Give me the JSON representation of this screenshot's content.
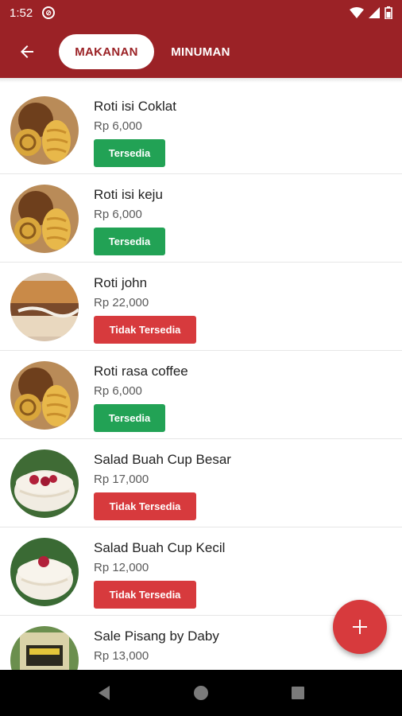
{
  "status_bar": {
    "time": "1:52",
    "badge_icon": "do-not-disturb-icon",
    "icons": [
      "wifi-icon",
      "signal-icon",
      "battery-icon"
    ]
  },
  "app_bar": {
    "back_icon": "arrow-left-icon",
    "tabs": [
      {
        "label": "MAKANAN",
        "active": true
      },
      {
        "label": "MINUMAN",
        "active": false
      }
    ],
    "color": "#9b2226"
  },
  "items": [
    {
      "name": "Roti isi Coklat",
      "price": "Rp 6,000",
      "status": "Tersedia",
      "available": true,
      "image": "bread-photo"
    },
    {
      "name": "Roti isi keju",
      "price": "Rp 6,000",
      "status": "Tersedia",
      "available": true,
      "image": "bread-photo"
    },
    {
      "name": "Roti john",
      "price": "Rp 22,000",
      "status": "Tidak Tersedia",
      "available": false,
      "image": "sandwich-photo"
    },
    {
      "name": "Roti rasa coffee",
      "price": "Rp 6,000",
      "status": "Tersedia",
      "available": true,
      "image": "bread-photo"
    },
    {
      "name": "Salad Buah Cup Besar",
      "price": "Rp 17,000",
      "status": "Tidak Tersedia",
      "available": false,
      "image": "salad-photo"
    },
    {
      "name": "Salad Buah Cup Kecil",
      "price": "Rp 12,000",
      "status": "Tidak Tersedia",
      "available": false,
      "image": "salad-photo"
    },
    {
      "name": "Sale Pisang by Daby",
      "price": "Rp 13,000",
      "status": "",
      "available": true,
      "image": "banana-snack-photo"
    }
  ],
  "fab": {
    "icon": "plus-icon",
    "color": "#d73a3d"
  },
  "colors": {
    "available": "#22a255",
    "unavailable": "#d73a3d"
  },
  "nav": [
    "back-triangle-icon",
    "home-circle-icon",
    "recents-square-icon"
  ]
}
